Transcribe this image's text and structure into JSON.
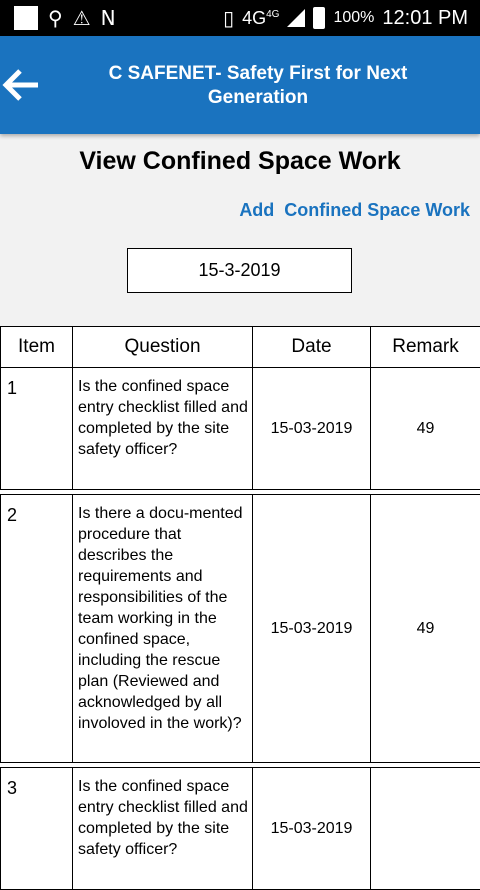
{
  "statusbar": {
    "network": "4G",
    "network_sup": "4G",
    "battery": "100%",
    "time": "12:01 PM",
    "icons": [
      "notification-square-icon",
      "usb-icon",
      "warning-icon",
      "n-icon",
      "vibrate-icon",
      "signal-icon",
      "battery-icon"
    ]
  },
  "appbar": {
    "title": "C SAFENET- Safety First for Next Generation",
    "back_icon": "arrow-left-icon",
    "color": "#1a73bf"
  },
  "page": {
    "title": "View Confined Space Work",
    "add_link": "Add  Confined Space Work",
    "date_value": "15-3-2019"
  },
  "table": {
    "headers": [
      "Item",
      "Question",
      "Date",
      "Remark"
    ],
    "rows": [
      {
        "item": "1",
        "question": "Is the confined space entry checklist filled and completed by the site safety officer?",
        "date": "15-03-2019",
        "remark": "49"
      },
      {
        "item": "2",
        "question": "Is there a docu-mented procedure that describes the requirements and responsibilities of the team working in the confined space, including the rescue plan (Reviewed and acknowledged by all involoved in the work)?",
        "date": "15-03-2019",
        "remark": "49"
      },
      {
        "item": "3",
        "question": "Is the confined space entry checklist filled and completed by the site safety officer?",
        "date": "15-03-2019",
        "remark": ""
      }
    ]
  }
}
